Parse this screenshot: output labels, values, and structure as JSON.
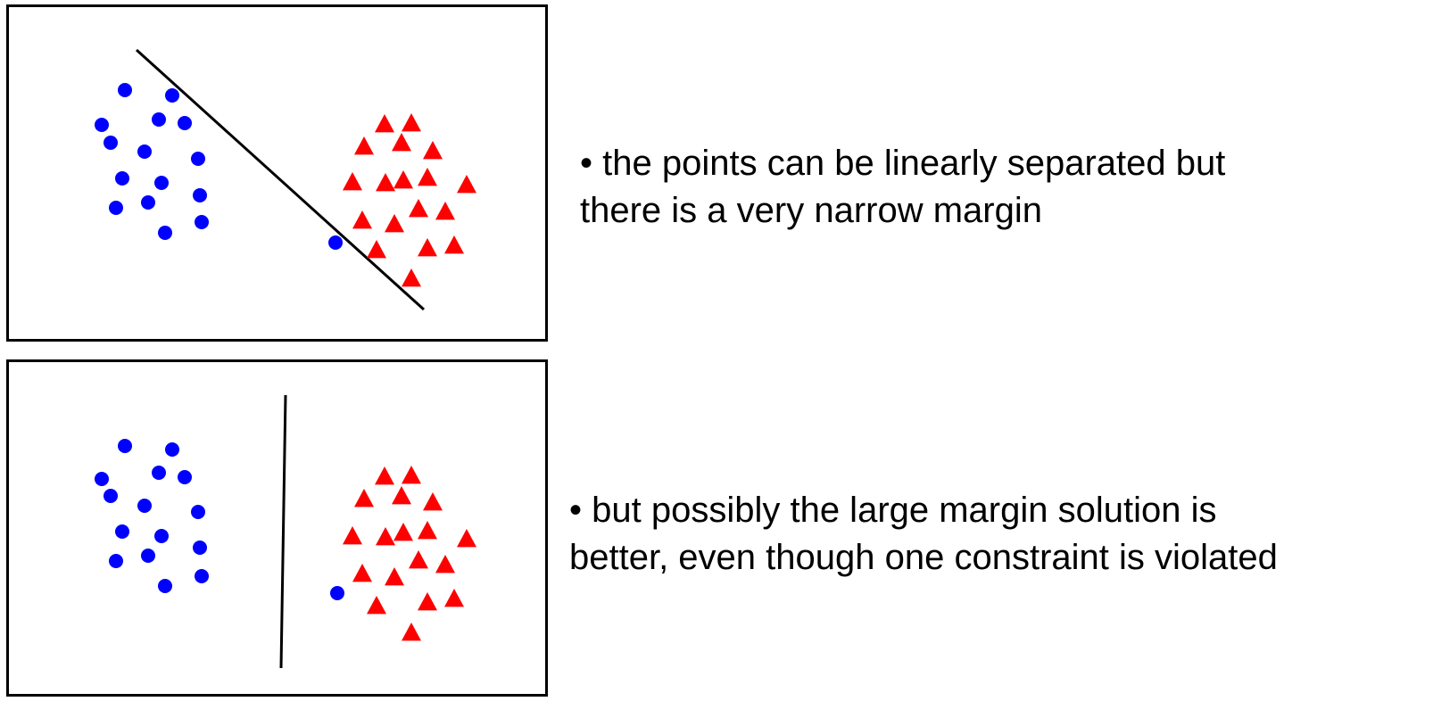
{
  "colors": {
    "class_a": "#0000ff",
    "class_b": "#ff0000",
    "line": "#000000",
    "border": "#000000"
  },
  "panels": [
    {
      "caption": {
        "line1": "• the points can be linearly separated but",
        "line2": "there is a very narrow margin"
      },
      "class_a_shape": "circle",
      "class_b_shape": "triangle",
      "note": ""
    },
    {
      "caption": {
        "line1": "• but possibly the large margin solution is",
        "line2": "better, even though one constraint is violated"
      },
      "class_a_shape": "circle",
      "class_b_shape": "triangle",
      "note": ""
    }
  ]
}
